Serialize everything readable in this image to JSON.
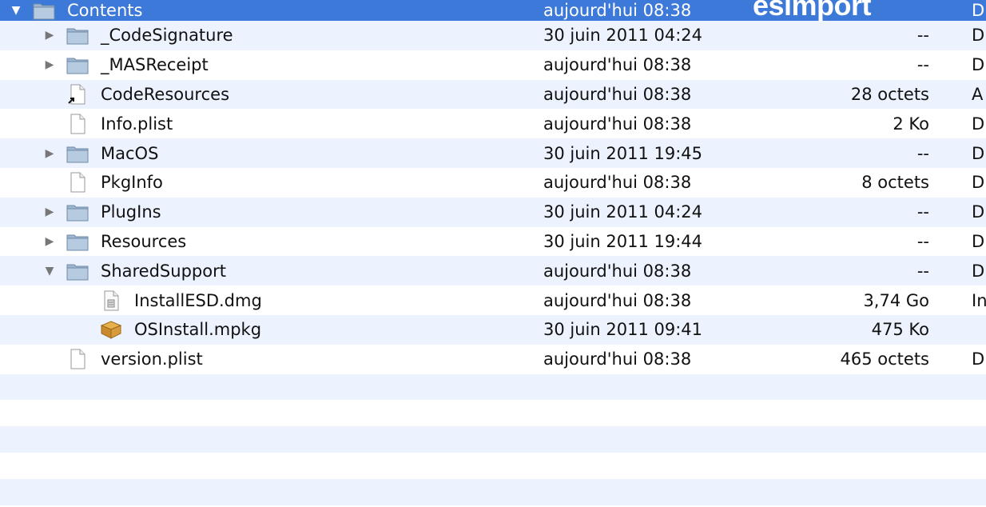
{
  "watermark": "esimport",
  "files": [
    {
      "name": "Contents",
      "date": "aujourd'hui 08:38",
      "size": "--",
      "kind": "D",
      "icon": "folder",
      "level": 0,
      "disclosure": "open",
      "selected": true
    },
    {
      "name": "_CodeSignature",
      "date": "30 juin 2011 04:24",
      "size": "--",
      "kind": "D",
      "icon": "folder",
      "level": 1,
      "disclosure": "closed"
    },
    {
      "name": "_MASReceipt",
      "date": "aujourd'hui 08:38",
      "size": "--",
      "kind": "D",
      "icon": "folder",
      "level": 1,
      "disclosure": "closed"
    },
    {
      "name": "CodeResources",
      "date": "aujourd'hui 08:38",
      "size": "28 octets",
      "kind": "A",
      "icon": "alias",
      "level": 1,
      "disclosure": "none"
    },
    {
      "name": "Info.plist",
      "date": "aujourd'hui 08:38",
      "size": "2 Ko",
      "kind": "D",
      "icon": "document",
      "level": 1,
      "disclosure": "none"
    },
    {
      "name": "MacOS",
      "date": "30 juin 2011 19:45",
      "size": "--",
      "kind": "D",
      "icon": "folder",
      "level": 1,
      "disclosure": "closed"
    },
    {
      "name": "PkgInfo",
      "date": "aujourd'hui 08:38",
      "size": "8 octets",
      "kind": "D",
      "icon": "document",
      "level": 1,
      "disclosure": "none"
    },
    {
      "name": "PlugIns",
      "date": "30 juin 2011 04:24",
      "size": "--",
      "kind": "D",
      "icon": "folder",
      "level": 1,
      "disclosure": "closed"
    },
    {
      "name": "Resources",
      "date": "30 juin 2011 19:44",
      "size": "--",
      "kind": "D",
      "icon": "folder",
      "level": 1,
      "disclosure": "closed"
    },
    {
      "name": "SharedSupport",
      "date": "aujourd'hui 08:38",
      "size": "--",
      "kind": "D",
      "icon": "folder",
      "level": 1,
      "disclosure": "open"
    },
    {
      "name": "InstallESD.dmg",
      "date": "aujourd'hui 08:38",
      "size": "3,74 Go",
      "kind": "In",
      "icon": "disk-image",
      "level": 2,
      "disclosure": "none"
    },
    {
      "name": "OSInstall.mpkg",
      "date": "30 juin 2011 09:41",
      "size": "475 Ko",
      "kind": "",
      "icon": "package",
      "level": 2,
      "disclosure": "none"
    },
    {
      "name": "version.plist",
      "date": "aujourd'hui 08:38",
      "size": "465 octets",
      "kind": "D",
      "icon": "document",
      "level": 1,
      "disclosure": "none"
    }
  ],
  "empty_rows": 5,
  "colors": {
    "selection": "#3d79d8",
    "stripe": "#edf3fe",
    "folder": "#9fb6d0"
  }
}
